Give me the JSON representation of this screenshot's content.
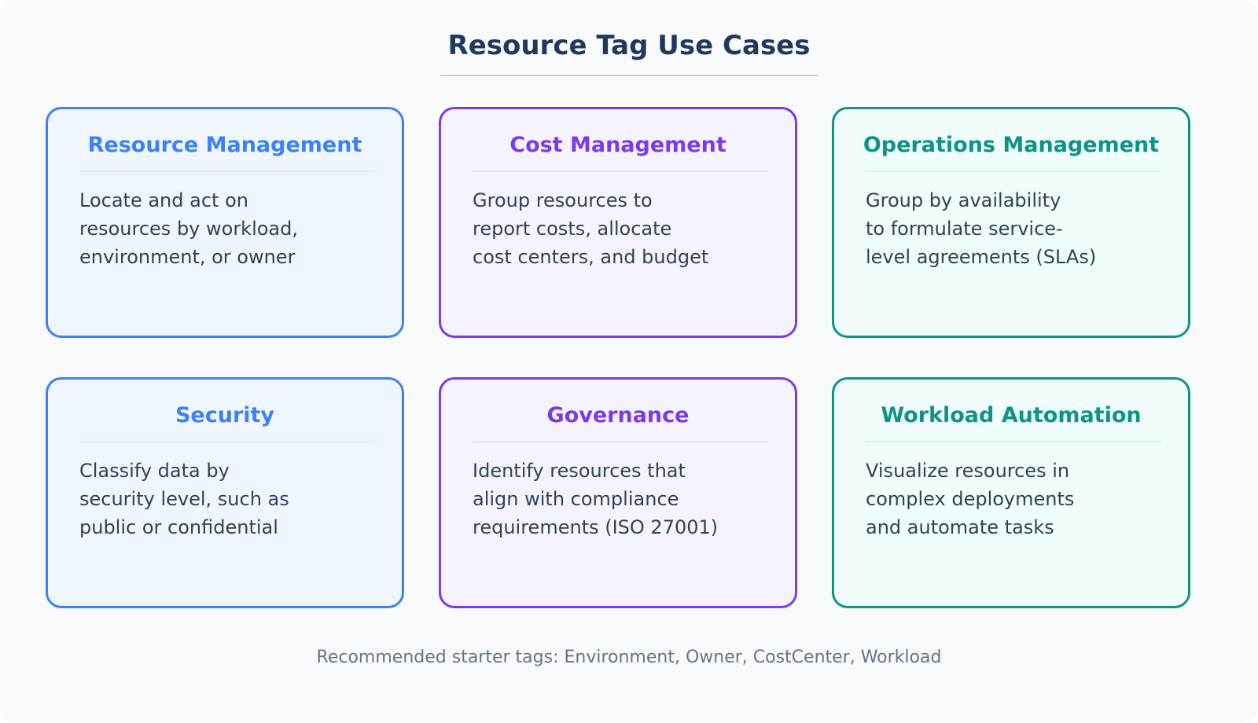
{
  "title": "Resource Tag Use Cases",
  "colors": {
    "blue": "#3b82f6",
    "purple": "#7c3aed",
    "teal": "#0d9488",
    "title": "#1e3a5f",
    "body_text": "#334155",
    "footer_text": "#64748b"
  },
  "cards": [
    {
      "title": "Resource Management",
      "lines": [
        "Locate and act on",
        "resources by workload,",
        "environment, or owner"
      ]
    },
    {
      "title": "Cost Management",
      "lines": [
        "Group resources to",
        "report costs, allocate",
        "cost centers, and budget"
      ]
    },
    {
      "title": "Operations Management",
      "lines": [
        "Group by availability",
        "to formulate service-",
        "level agreements (SLAs)"
      ]
    },
    {
      "title": "Security",
      "lines": [
        "Classify data by",
        "security level, such as",
        "public or confidential"
      ]
    },
    {
      "title": "Governance",
      "lines": [
        "Identify resources that",
        "align with compliance",
        "requirements (ISO 27001)"
      ]
    },
    {
      "title": "Workload Automation",
      "lines": [
        "Visualize resources in",
        "complex deployments",
        "and automate tasks"
      ]
    }
  ],
  "footer": "Recommended starter tags: Environment, Owner, CostCenter, Workload"
}
